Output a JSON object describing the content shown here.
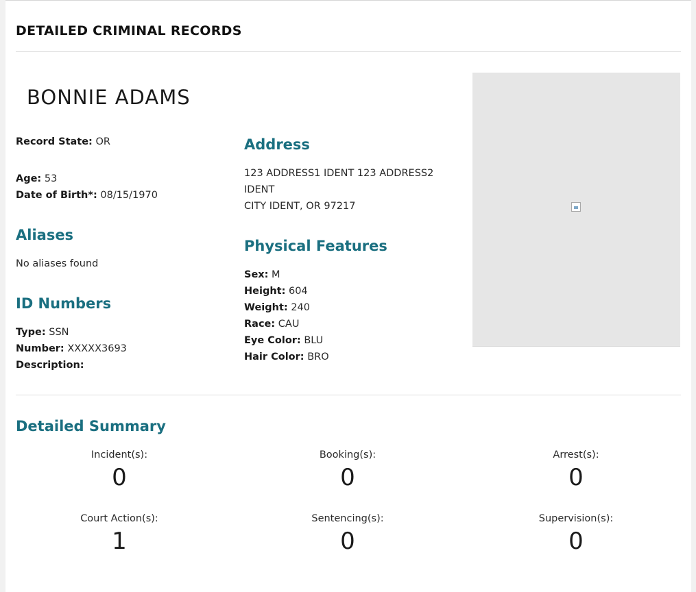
{
  "page_title": "DETAILED CRIMINAL RECORDS",
  "person_name": "BONNIE ADAMS",
  "record": {
    "state_label": "Record State:",
    "state_value": "OR",
    "age_label": "Age:",
    "age_value": "53",
    "dob_label": "Date of Birth*:",
    "dob_value": "08/15/1970"
  },
  "aliases": {
    "heading": "Aliases",
    "text": "No aliases found"
  },
  "id_numbers": {
    "heading": "ID Numbers",
    "type_label": "Type:",
    "type_value": "SSN",
    "number_label": "Number:",
    "number_value": "XXXXX3693",
    "description_label": "Description:",
    "description_value": ""
  },
  "address": {
    "heading": "Address",
    "line1": "123 ADDRESS1 IDENT 123 ADDRESS2",
    "line2": "IDENT",
    "line3": "CITY IDENT, OR 97217"
  },
  "physical": {
    "heading": "Physical Features",
    "sex_label": "Sex:",
    "sex_value": "M",
    "height_label": "Height:",
    "height_value": "604",
    "weight_label": "Weight:",
    "weight_value": "240",
    "race_label": "Race:",
    "race_value": "CAU",
    "eye_label": "Eye Color:",
    "eye_value": "BLU",
    "hair_label": "Hair Color:",
    "hair_value": "BRO"
  },
  "summary": {
    "heading": "Detailed Summary",
    "incidents_label": "Incident(s):",
    "incidents_value": "0",
    "bookings_label": "Booking(s):",
    "bookings_value": "0",
    "arrests_label": "Arrest(s):",
    "arrests_value": "0",
    "court_label": "Court Action(s):",
    "court_value": "1",
    "sentencing_label": "Sentencing(s):",
    "sentencing_value": "0",
    "supervision_label": "Supervision(s):",
    "supervision_value": "0"
  },
  "colors": {
    "heading_accent": "#1a6f80",
    "photo_background": "#e6e6e6"
  },
  "icons": {
    "photo": "broken-image-icon"
  }
}
